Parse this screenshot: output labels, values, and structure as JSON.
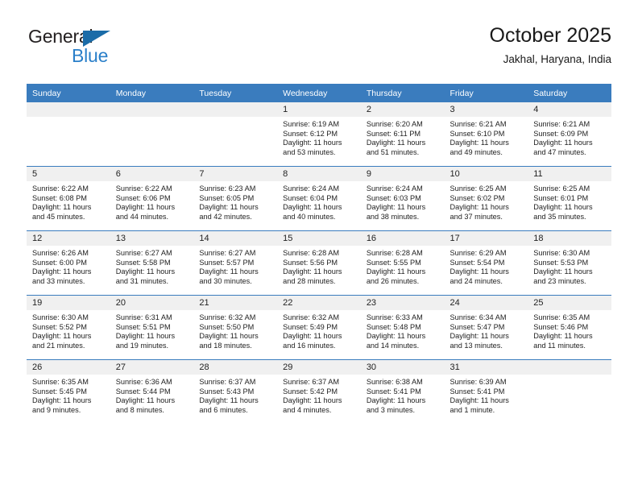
{
  "brand": {
    "name_part1": "General",
    "name_part2": "Blue",
    "triangle_color": "#1b6ca8",
    "blue_color": "#2a7fc9"
  },
  "header": {
    "title": "October 2025",
    "subtitle": "Jakhal, Haryana, India"
  },
  "theme": {
    "header_row_color": "#3a7cbe",
    "daynum_band_color": "#f0f0f0",
    "grid_line_color": "#3a7cbe"
  },
  "weekdays": [
    "Sunday",
    "Monday",
    "Tuesday",
    "Wednesday",
    "Thursday",
    "Friday",
    "Saturday"
  ],
  "weeks": [
    [
      {
        "day": "",
        "sunrise": "",
        "sunset": "",
        "daylight": ""
      },
      {
        "day": "",
        "sunrise": "",
        "sunset": "",
        "daylight": ""
      },
      {
        "day": "",
        "sunrise": "",
        "sunset": "",
        "daylight": ""
      },
      {
        "day": "1",
        "sunrise": "Sunrise: 6:19 AM",
        "sunset": "Sunset: 6:12 PM",
        "daylight": "Daylight: 11 hours and 53 minutes."
      },
      {
        "day": "2",
        "sunrise": "Sunrise: 6:20 AM",
        "sunset": "Sunset: 6:11 PM",
        "daylight": "Daylight: 11 hours and 51 minutes."
      },
      {
        "day": "3",
        "sunrise": "Sunrise: 6:21 AM",
        "sunset": "Sunset: 6:10 PM",
        "daylight": "Daylight: 11 hours and 49 minutes."
      },
      {
        "day": "4",
        "sunrise": "Sunrise: 6:21 AM",
        "sunset": "Sunset: 6:09 PM",
        "daylight": "Daylight: 11 hours and 47 minutes."
      }
    ],
    [
      {
        "day": "5",
        "sunrise": "Sunrise: 6:22 AM",
        "sunset": "Sunset: 6:08 PM",
        "daylight": "Daylight: 11 hours and 45 minutes."
      },
      {
        "day": "6",
        "sunrise": "Sunrise: 6:22 AM",
        "sunset": "Sunset: 6:06 PM",
        "daylight": "Daylight: 11 hours and 44 minutes."
      },
      {
        "day": "7",
        "sunrise": "Sunrise: 6:23 AM",
        "sunset": "Sunset: 6:05 PM",
        "daylight": "Daylight: 11 hours and 42 minutes."
      },
      {
        "day": "8",
        "sunrise": "Sunrise: 6:24 AM",
        "sunset": "Sunset: 6:04 PM",
        "daylight": "Daylight: 11 hours and 40 minutes."
      },
      {
        "day": "9",
        "sunrise": "Sunrise: 6:24 AM",
        "sunset": "Sunset: 6:03 PM",
        "daylight": "Daylight: 11 hours and 38 minutes."
      },
      {
        "day": "10",
        "sunrise": "Sunrise: 6:25 AM",
        "sunset": "Sunset: 6:02 PM",
        "daylight": "Daylight: 11 hours and 37 minutes."
      },
      {
        "day": "11",
        "sunrise": "Sunrise: 6:25 AM",
        "sunset": "Sunset: 6:01 PM",
        "daylight": "Daylight: 11 hours and 35 minutes."
      }
    ],
    [
      {
        "day": "12",
        "sunrise": "Sunrise: 6:26 AM",
        "sunset": "Sunset: 6:00 PM",
        "daylight": "Daylight: 11 hours and 33 minutes."
      },
      {
        "day": "13",
        "sunrise": "Sunrise: 6:27 AM",
        "sunset": "Sunset: 5:58 PM",
        "daylight": "Daylight: 11 hours and 31 minutes."
      },
      {
        "day": "14",
        "sunrise": "Sunrise: 6:27 AM",
        "sunset": "Sunset: 5:57 PM",
        "daylight": "Daylight: 11 hours and 30 minutes."
      },
      {
        "day": "15",
        "sunrise": "Sunrise: 6:28 AM",
        "sunset": "Sunset: 5:56 PM",
        "daylight": "Daylight: 11 hours and 28 minutes."
      },
      {
        "day": "16",
        "sunrise": "Sunrise: 6:28 AM",
        "sunset": "Sunset: 5:55 PM",
        "daylight": "Daylight: 11 hours and 26 minutes."
      },
      {
        "day": "17",
        "sunrise": "Sunrise: 6:29 AM",
        "sunset": "Sunset: 5:54 PM",
        "daylight": "Daylight: 11 hours and 24 minutes."
      },
      {
        "day": "18",
        "sunrise": "Sunrise: 6:30 AM",
        "sunset": "Sunset: 5:53 PM",
        "daylight": "Daylight: 11 hours and 23 minutes."
      }
    ],
    [
      {
        "day": "19",
        "sunrise": "Sunrise: 6:30 AM",
        "sunset": "Sunset: 5:52 PM",
        "daylight": "Daylight: 11 hours and 21 minutes."
      },
      {
        "day": "20",
        "sunrise": "Sunrise: 6:31 AM",
        "sunset": "Sunset: 5:51 PM",
        "daylight": "Daylight: 11 hours and 19 minutes."
      },
      {
        "day": "21",
        "sunrise": "Sunrise: 6:32 AM",
        "sunset": "Sunset: 5:50 PM",
        "daylight": "Daylight: 11 hours and 18 minutes."
      },
      {
        "day": "22",
        "sunrise": "Sunrise: 6:32 AM",
        "sunset": "Sunset: 5:49 PM",
        "daylight": "Daylight: 11 hours and 16 minutes."
      },
      {
        "day": "23",
        "sunrise": "Sunrise: 6:33 AM",
        "sunset": "Sunset: 5:48 PM",
        "daylight": "Daylight: 11 hours and 14 minutes."
      },
      {
        "day": "24",
        "sunrise": "Sunrise: 6:34 AM",
        "sunset": "Sunset: 5:47 PM",
        "daylight": "Daylight: 11 hours and 13 minutes."
      },
      {
        "day": "25",
        "sunrise": "Sunrise: 6:35 AM",
        "sunset": "Sunset: 5:46 PM",
        "daylight": "Daylight: 11 hours and 11 minutes."
      }
    ],
    [
      {
        "day": "26",
        "sunrise": "Sunrise: 6:35 AM",
        "sunset": "Sunset: 5:45 PM",
        "daylight": "Daylight: 11 hours and 9 minutes."
      },
      {
        "day": "27",
        "sunrise": "Sunrise: 6:36 AM",
        "sunset": "Sunset: 5:44 PM",
        "daylight": "Daylight: 11 hours and 8 minutes."
      },
      {
        "day": "28",
        "sunrise": "Sunrise: 6:37 AM",
        "sunset": "Sunset: 5:43 PM",
        "daylight": "Daylight: 11 hours and 6 minutes."
      },
      {
        "day": "29",
        "sunrise": "Sunrise: 6:37 AM",
        "sunset": "Sunset: 5:42 PM",
        "daylight": "Daylight: 11 hours and 4 minutes."
      },
      {
        "day": "30",
        "sunrise": "Sunrise: 6:38 AM",
        "sunset": "Sunset: 5:41 PM",
        "daylight": "Daylight: 11 hours and 3 minutes."
      },
      {
        "day": "31",
        "sunrise": "Sunrise: 6:39 AM",
        "sunset": "Sunset: 5:41 PM",
        "daylight": "Daylight: 11 hours and 1 minute."
      },
      {
        "day": "",
        "sunrise": "",
        "sunset": "",
        "daylight": ""
      }
    ]
  ]
}
